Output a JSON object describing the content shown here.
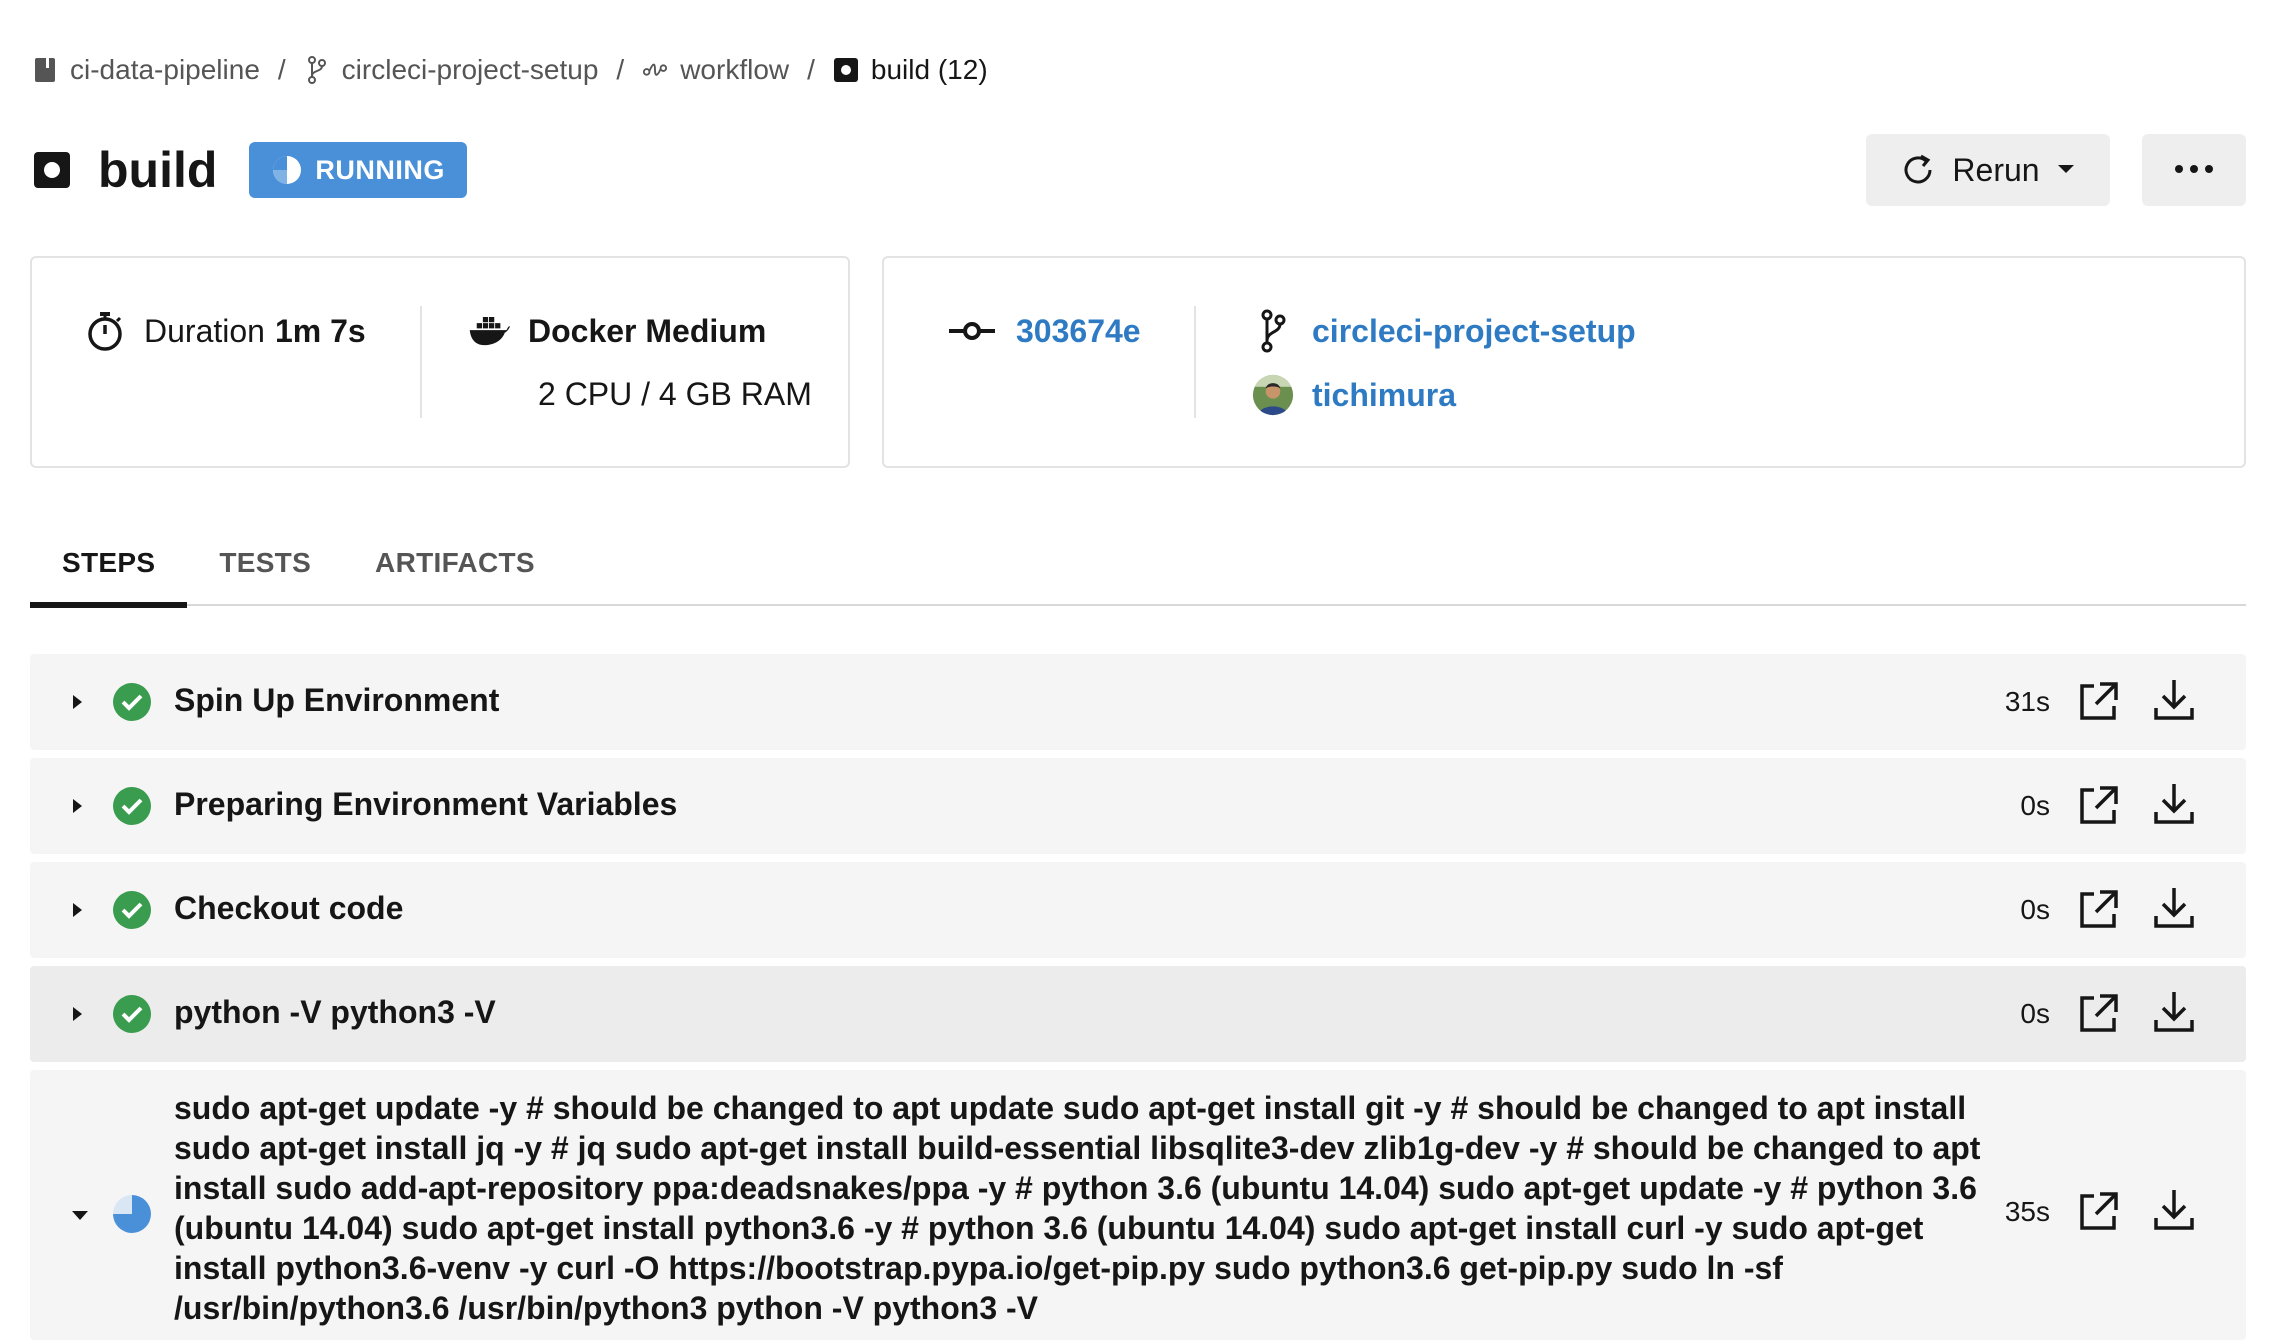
{
  "breadcrumb": {
    "project": "ci-data-pipeline",
    "branch": "circleci-project-setup",
    "workflow": "workflow",
    "job": "build (12)"
  },
  "header": {
    "job_name": "build",
    "status": "RUNNING",
    "rerun_label": "Rerun",
    "more_label": "•••"
  },
  "info": {
    "duration_label": "Duration",
    "duration_value": "1m 7s",
    "executor_name": "Docker Medium",
    "executor_spec": "2 CPU / 4 GB RAM",
    "commit": "303674e",
    "branch": "circleci-project-setup",
    "author": "tichimura"
  },
  "tabs": [
    {
      "label": "STEPS",
      "active": true
    },
    {
      "label": "TESTS",
      "active": false
    },
    {
      "label": "ARTIFACTS",
      "active": false
    }
  ],
  "steps": [
    {
      "name": "Spin Up Environment",
      "duration": "31s",
      "status": "success"
    },
    {
      "name": "Preparing Environment Variables",
      "duration": "0s",
      "status": "success"
    },
    {
      "name": "Checkout code",
      "duration": "0s",
      "status": "success"
    },
    {
      "name": "python -V python3 -V",
      "duration": "0s",
      "status": "success"
    },
    {
      "name": "sudo apt-get update -y # should be changed to apt update sudo apt-get install git -y # should be changed to apt install sudo apt-get install jq -y # jq sudo apt-get install build-essential libsqlite3-dev zlib1g-dev -y # should be changed to apt install sudo add-apt-repository ppa:deadsnakes/ppa -y # python 3.6 (ubuntu 14.04) sudo apt-get update -y # python 3.6 (ubuntu 14.04) sudo apt-get install python3.6 -y # python 3.6 (ubuntu 14.04) sudo apt-get install curl -y sudo apt-get install python3.6-venv -y curl -O https://bootstrap.pypa.io/get-pip.py sudo python3.6 get-pip.py sudo ln -sf /usr/bin/python3.6 /usr/bin/python3 python -V python3 -V",
      "duration": "35s",
      "status": "running"
    }
  ],
  "colors": {
    "accent": "#4a90d9",
    "link": "#2e7bc4",
    "success": "#3a9c4f"
  }
}
